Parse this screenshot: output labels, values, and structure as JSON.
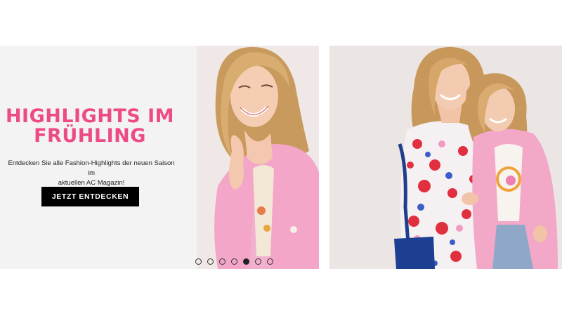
{
  "hero": {
    "headline_line1": "HIGHLIGHTS IM",
    "headline_line2": "FRÜHLING",
    "subtext_line1": "Entdecken Sie alle Fashion-Highlights der neuen Saison im",
    "subtext_line2": "aktuellen AC Magazin!",
    "cta_label": "JETZT ENTDECKEN",
    "accent_color": "#ec4b85"
  },
  "carousel": {
    "slide_count": 7,
    "active_index": 4
  }
}
